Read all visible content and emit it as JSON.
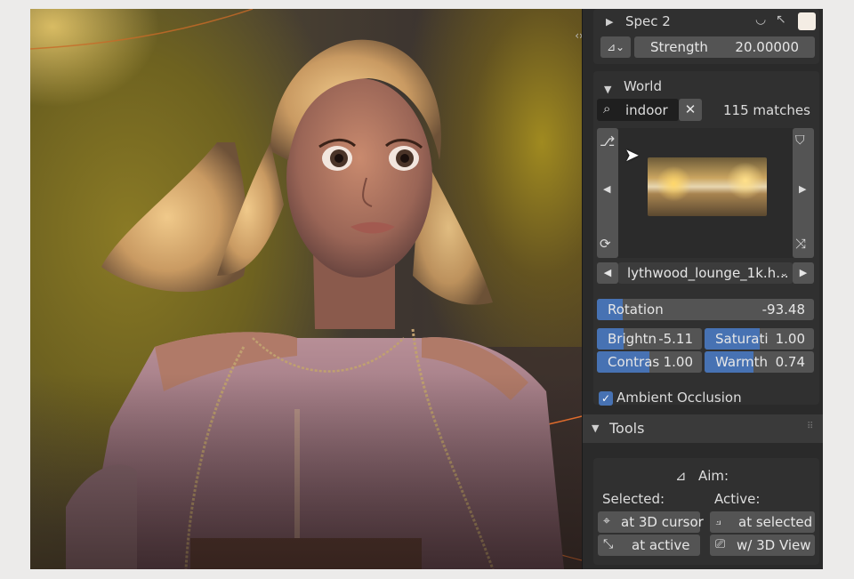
{
  "spec_panel": {
    "title": "Spec 2",
    "strength_label": "Strength",
    "strength_value": "20.00000",
    "swatch_color": "#f4ede4"
  },
  "world_panel": {
    "title": "World",
    "search_value": "indoor",
    "matches": "115 matches",
    "hdri_name": "lythwood_lounge_1k.h...",
    "rotation_label": "Rotation",
    "rotation_value": "-93.48",
    "rotation_fill": 0.12,
    "brightness_label": "Brightn",
    "brightness_value": "-5.11",
    "brightness_fill": 0.25,
    "saturation_label": "Saturati",
    "saturation_value": "1.00",
    "saturation_fill": 0.5,
    "contrast_label": "Contras",
    "contrast_value": "1.00",
    "contrast_fill": 0.5,
    "warmth_label": "Warmth",
    "warmth_value": "0.74",
    "warmth_fill": 0.45,
    "ambient_occlusion_label": "Ambient Occlusion",
    "ambient_occlusion_checked": true
  },
  "tools_panel": {
    "title": "Tools",
    "aim_label": "Aim:",
    "selected_label": "Selected:",
    "active_label": "Active:",
    "btn_at_3d_cursor": "at 3D cursor",
    "btn_at_selected": "at selected",
    "btn_at_active": "at active",
    "btn_w_3d_view": "w/ 3D View"
  },
  "colors": {
    "accent": "#4772b3",
    "panel_bg": "#303030",
    "sidebar_bg": "#2a2a2a",
    "field_bg": "#545454"
  }
}
